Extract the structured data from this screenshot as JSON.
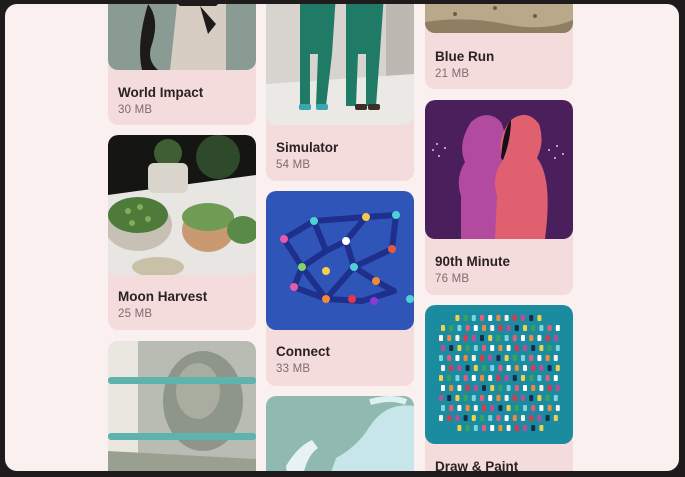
{
  "apps": [
    {
      "title": "World Impact",
      "size": "30 MB",
      "image": "woman-portrait-illustration"
    },
    {
      "title": "Moon Harvest",
      "size": "25 MB",
      "image": "succulent-plants-photo"
    },
    {
      "title": "",
      "size": "",
      "image": "banknote-stack-photo"
    },
    {
      "title": "Simulator",
      "size": "54 MB",
      "image": "surgeons-walking-photo"
    },
    {
      "title": "Connect",
      "size": "33 MB",
      "image": "network-nodes-illustration"
    },
    {
      "title": "",
      "size": "",
      "image": "gloved-hands-photo"
    },
    {
      "title": "Blue Run",
      "size": "21 MB",
      "image": "dry-field-photo"
    },
    {
      "title": "90th Minute",
      "size": "76 MB",
      "image": "two-silhouettes-illustration"
    },
    {
      "title": "Draw & Paint",
      "size": "",
      "image": "paint-dabs-illustration"
    }
  ],
  "colors": {
    "screen_bg": "#faf0f0",
    "card_bg": "#f4dcdd",
    "frame": "#1f1b1c"
  }
}
